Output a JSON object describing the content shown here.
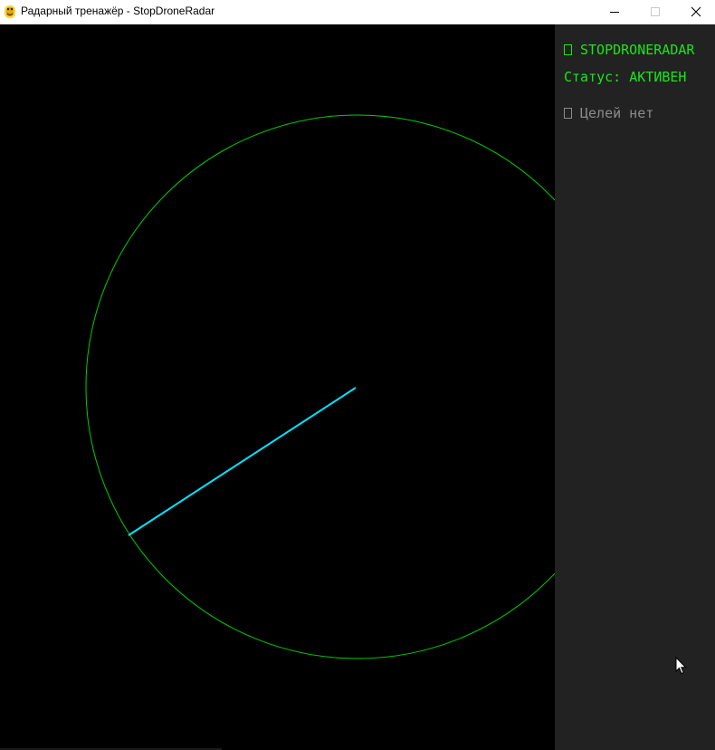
{
  "window": {
    "title": "Радарный тренажёр - StopDroneRadar",
    "app_icon": "python-snake-icon",
    "controls": [
      "minimize-icon",
      "maximize-icon",
      "close-icon"
    ]
  },
  "radar": {
    "background": "#000000",
    "ring_color": "#00cc00",
    "sweep_color": "#00e5ff"
  },
  "panel": {
    "title_glyph": "□",
    "title": "STOPDRONERADAR",
    "status_label": "Статус: АКТИВЕН",
    "targets_glyph": "□",
    "targets_text": "Целей нет",
    "background": "#222222",
    "text_color": "#19e619",
    "muted_color": "#8c8c8c"
  }
}
